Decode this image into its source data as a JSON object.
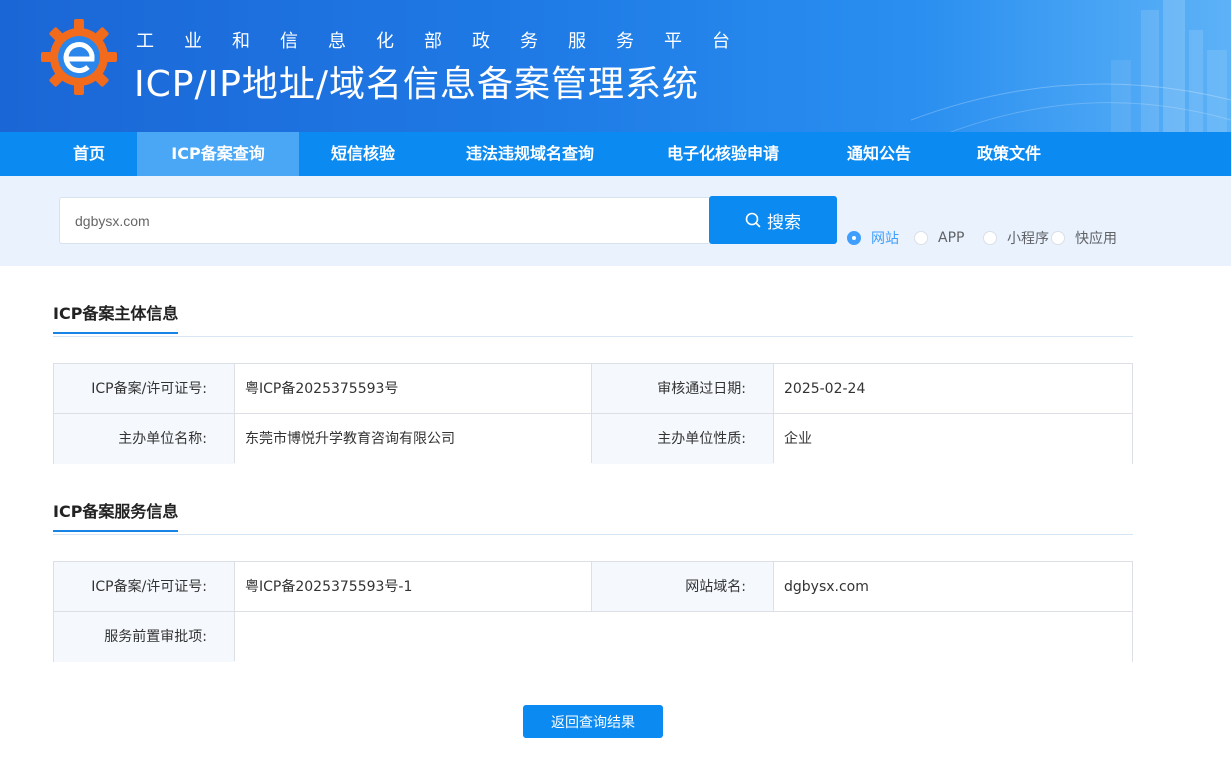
{
  "header": {
    "sub_title": "工业和信息化部政务服务平台",
    "main_title": "ICP/IP地址/域名信息备案管理系统",
    "logo_icon": "gear-e-logo-icon"
  },
  "nav": {
    "items": [
      {
        "label": "首页",
        "active": false
      },
      {
        "label": "ICP备案查询",
        "active": true
      },
      {
        "label": "短信核验",
        "active": false
      },
      {
        "label": "违法违规域名查询",
        "active": false
      },
      {
        "label": "电子化核验申请",
        "active": false
      },
      {
        "label": "通知公告",
        "active": false
      },
      {
        "label": "政策文件",
        "active": false
      }
    ]
  },
  "search": {
    "value": "dgbysx.com",
    "button_label": "搜索",
    "button_icon": "search-icon",
    "options": [
      {
        "label": "网站",
        "checked": true
      },
      {
        "label": "APP",
        "checked": false
      },
      {
        "label": "小程序",
        "checked": false
      },
      {
        "label": "快应用",
        "checked": false
      }
    ]
  },
  "subject_info": {
    "title": "ICP备案主体信息",
    "rows": [
      {
        "l1": "ICP备案/许可证号:",
        "v1": "粤ICP备2025375593号",
        "l2": "审核通过日期:",
        "v2": "2025-02-24"
      },
      {
        "l1": "主办单位名称:",
        "v1": "东莞市博悦升学教育咨询有限公司",
        "l2": "主办单位性质:",
        "v2": "企业"
      }
    ]
  },
  "service_info": {
    "title": "ICP备案服务信息",
    "row1": {
      "l1": "ICP备案/许可证号:",
      "v1": "粤ICP备2025375593号-1",
      "l2": "网站域名:",
      "v2": "dgbysx.com"
    },
    "row2": {
      "l1": "服务前置审批项:",
      "v1": ""
    }
  },
  "back_button_label": "返回查询结果",
  "colors": {
    "primary": "#0b8af2",
    "nav_active": "#4aa7f5",
    "radio_checked": "#409eff",
    "search_bg": "#e9f2fd",
    "label_bg": "#f5f9fe"
  }
}
